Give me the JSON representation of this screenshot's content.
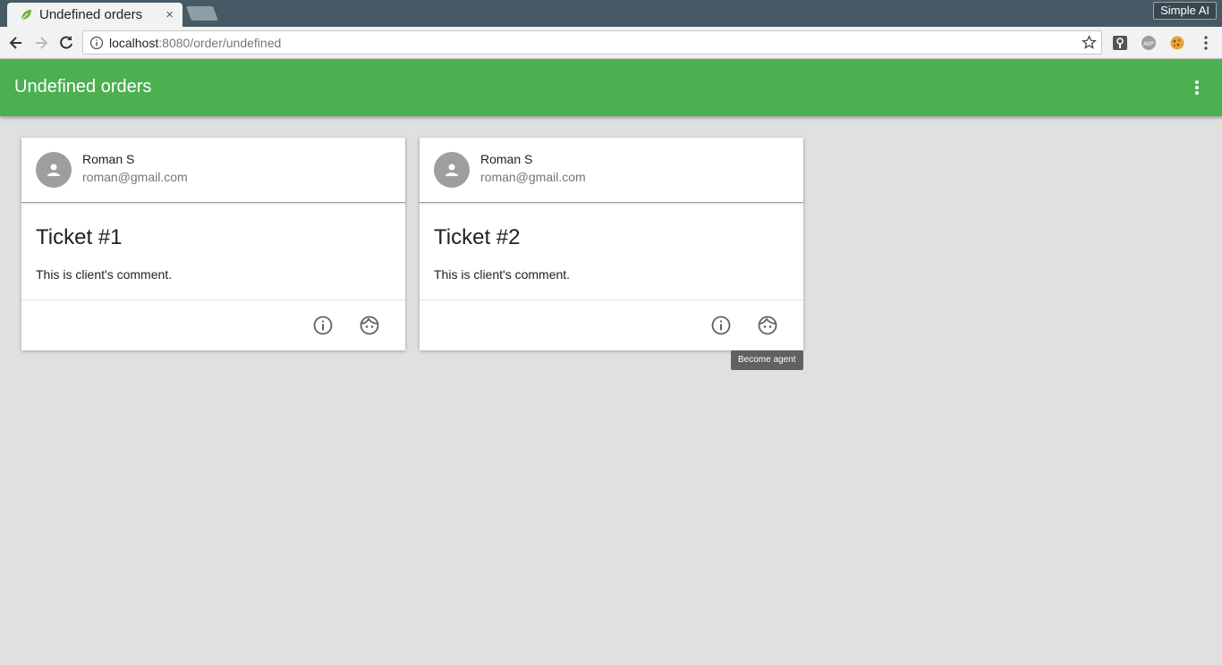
{
  "browser": {
    "tab_title": "Undefined orders",
    "tab_close": "×",
    "profile_label": "Simple AI",
    "url_host": "localhost",
    "url_path": ":8080/order/undefined"
  },
  "app": {
    "title": "Undefined orders",
    "accent": "#4caf50"
  },
  "cards": [
    {
      "name": "Roman S",
      "email": "roman@gmail.com",
      "title": "Ticket #1",
      "comment": "This is client's comment."
    },
    {
      "name": "Roman S",
      "email": "roman@gmail.com",
      "title": "Ticket #2",
      "comment": "This is client's comment."
    }
  ],
  "tooltip": "Become agent"
}
